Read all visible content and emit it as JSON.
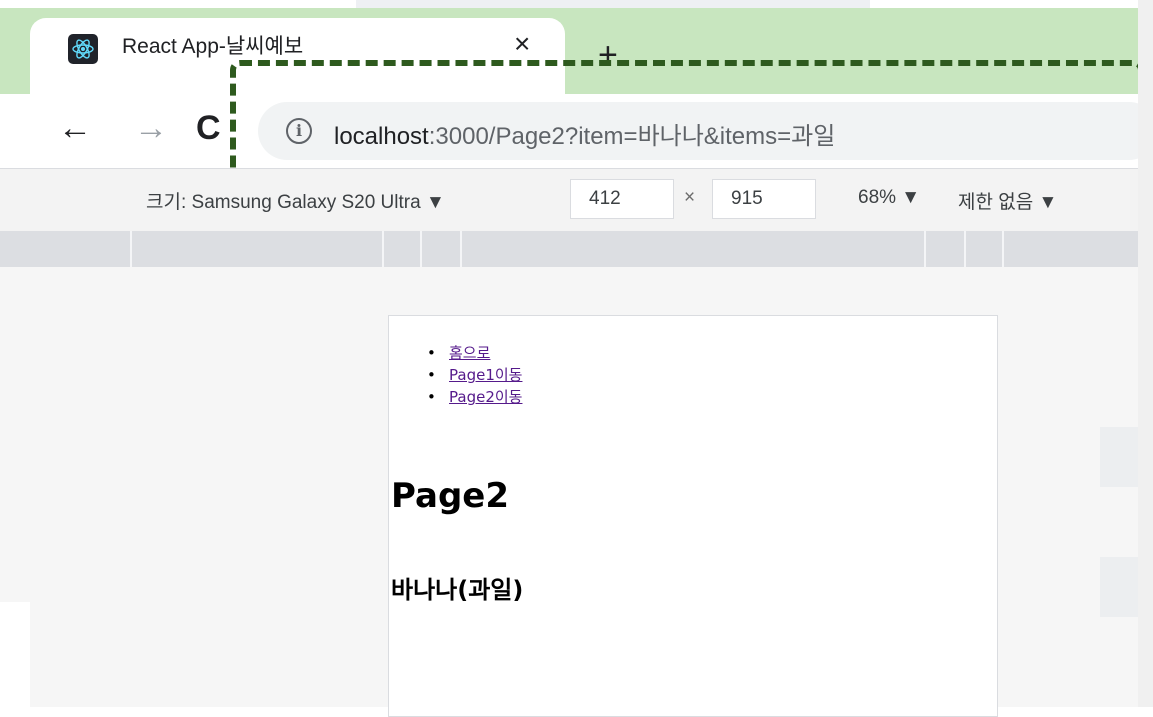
{
  "browser": {
    "tab": {
      "title": "React App-날씨예보",
      "close_glyph": "×",
      "favicon": "react-icon"
    },
    "new_tab_glyph": "+",
    "nav": {
      "back_glyph": "←",
      "forward_glyph": "→",
      "reload_glyph": "C"
    },
    "address_bar": {
      "info_glyph": "i",
      "url_host": "localhost",
      "url_rest": ":3000/Page2?item=바나나&items=과일"
    },
    "highlight_color": "#2e5a1e"
  },
  "device_toolbar": {
    "size_label": "크기: Samsung Galaxy S20 Ultra ▼",
    "width": "412",
    "times": "×",
    "height": "915",
    "zoom": "68% ▼",
    "throttle": "제한 없음 ▼"
  },
  "page": {
    "nav_links": [
      "홈으로",
      "Page1이동",
      "Page2이동"
    ],
    "heading": "Page2",
    "subheading": "바나나(과일)",
    "link_color": "#551a8b"
  }
}
